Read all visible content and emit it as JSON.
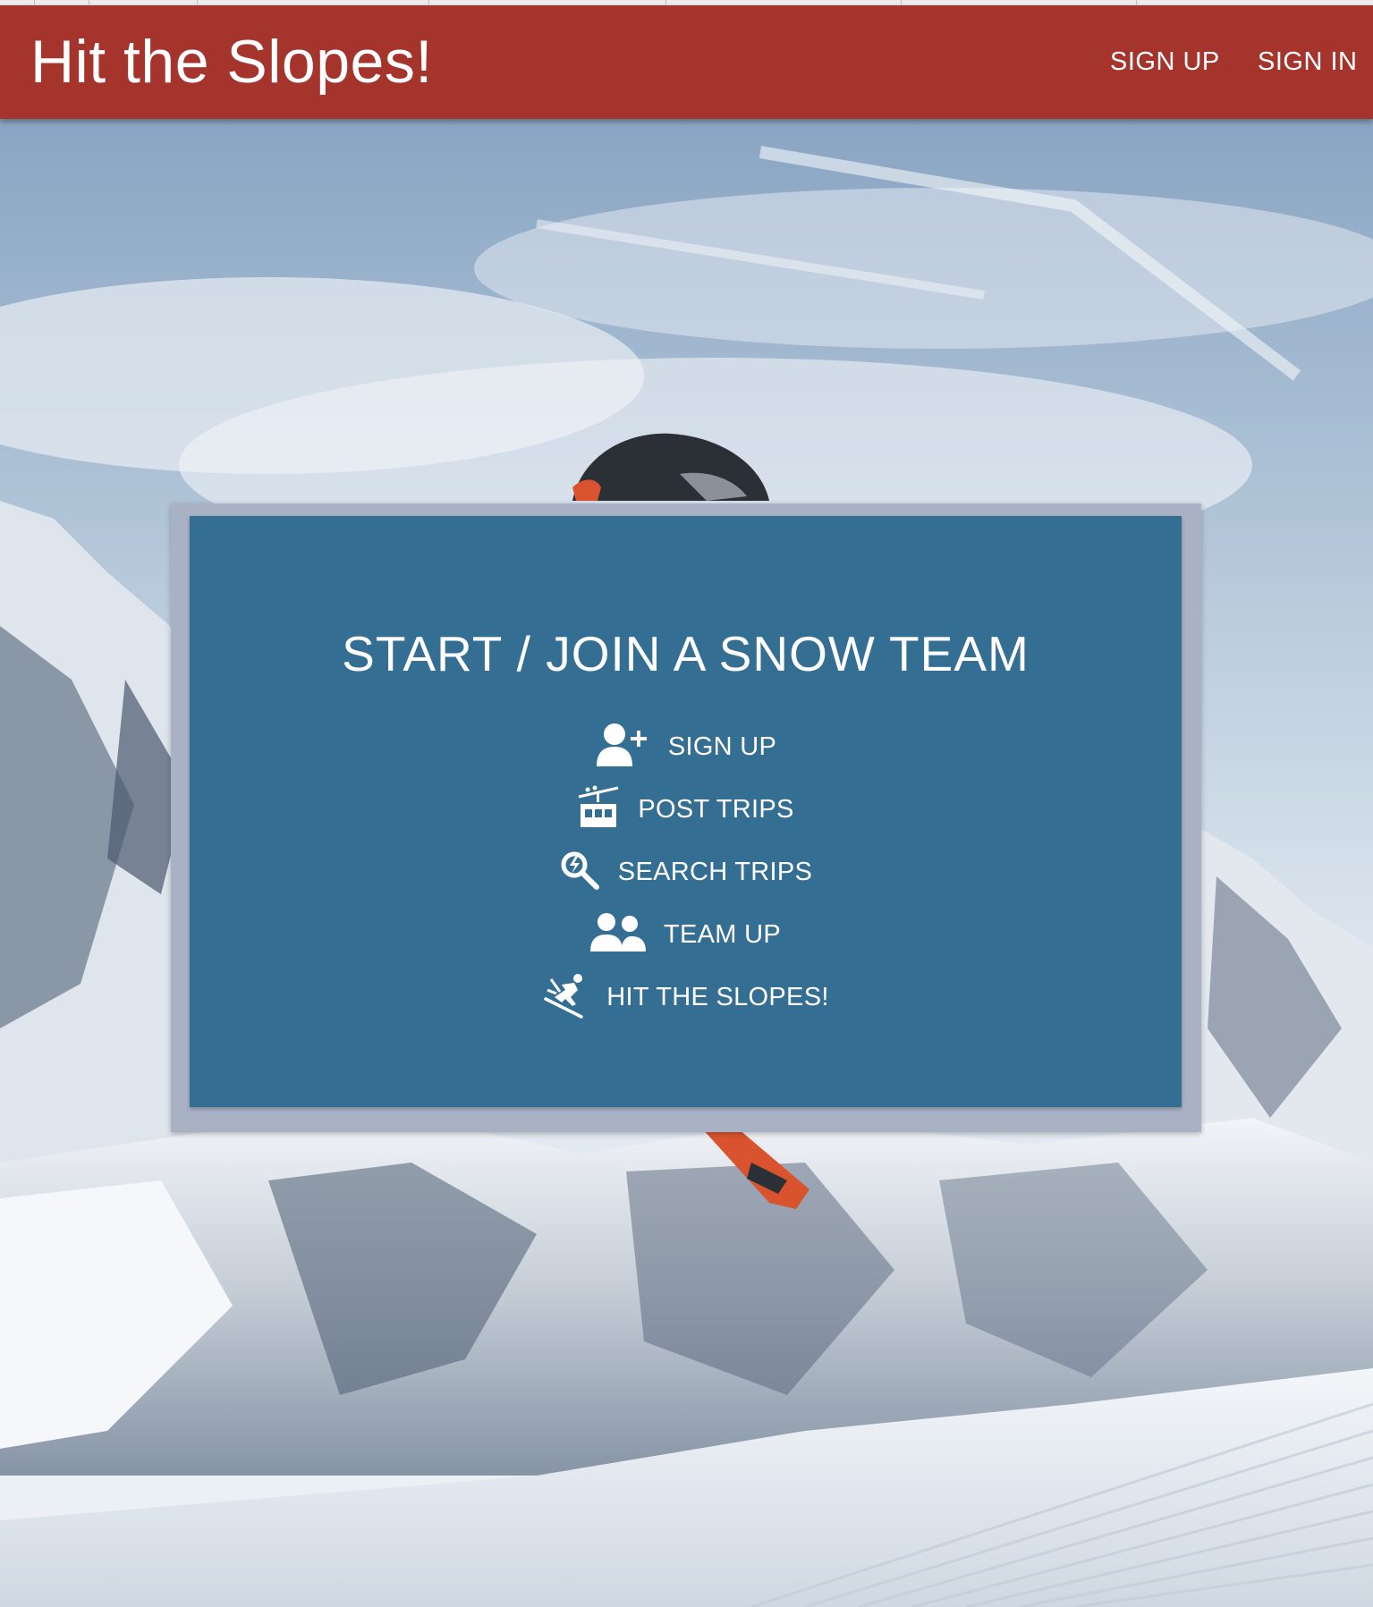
{
  "header": {
    "brand": "Hit the Slopes!",
    "nav": {
      "sign_up": "SIGN UP",
      "sign_in": "SIGN IN"
    },
    "bar_color": "#a5342d"
  },
  "card": {
    "title": "START / JOIN A SNOW TEAM",
    "background_color": "#356e93",
    "features": [
      {
        "icon": "add-user-icon",
        "label": "SIGN UP"
      },
      {
        "icon": "gondola-lift-icon",
        "label": "POST TRIPS"
      },
      {
        "icon": "search-trips-icon",
        "label": "SEARCH TRIPS"
      },
      {
        "icon": "team-users-icon",
        "label": "TEAM UP"
      },
      {
        "icon": "skier-icon",
        "label": "HIT THE SLOPES!"
      }
    ]
  },
  "background": {
    "image": "snowboarder-mountain-scene"
  }
}
